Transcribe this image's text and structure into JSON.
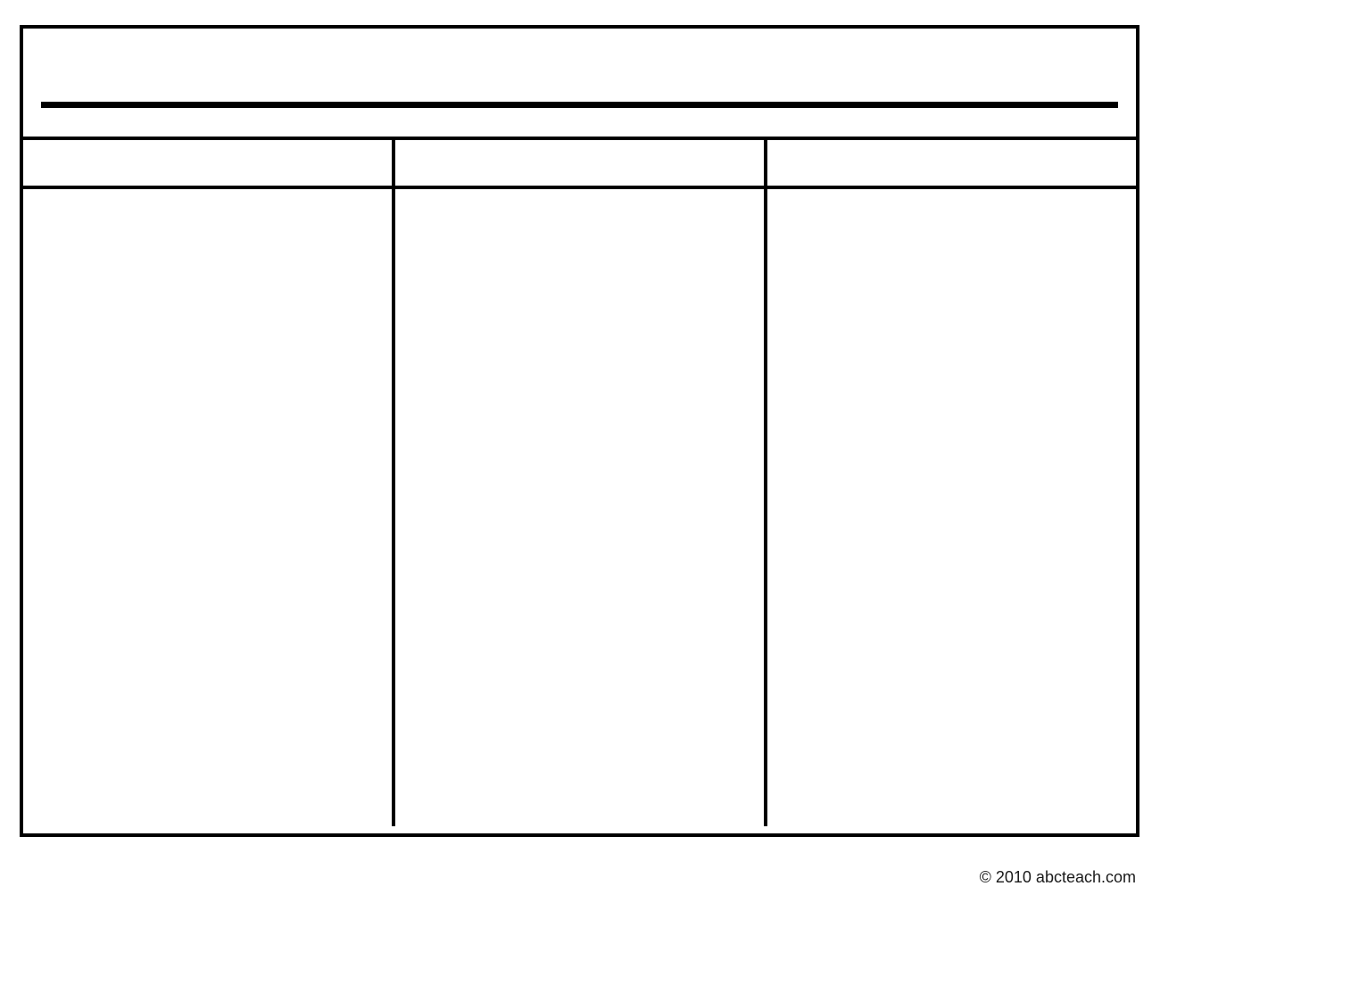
{
  "title_line_value": "",
  "columns": {
    "headers": [
      "",
      "",
      ""
    ],
    "body": [
      "",
      "",
      ""
    ]
  },
  "footer": {
    "copyright": "© 2010 abcteach.com"
  }
}
